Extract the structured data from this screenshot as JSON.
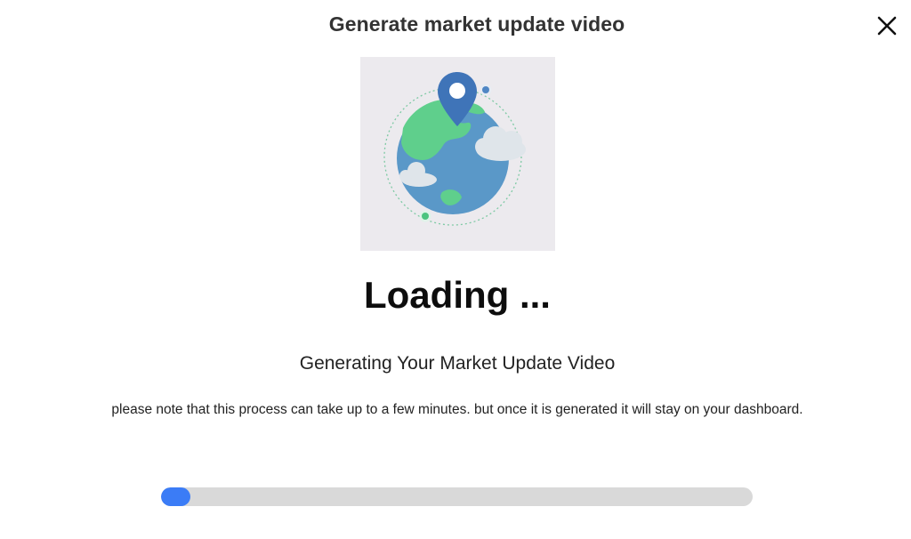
{
  "dialog": {
    "title": "Generate market update video",
    "close_icon": "close-icon",
    "illustration_icon": "globe-location-pin-icon"
  },
  "status": {
    "heading": "Loading ...",
    "subtitle": "Generating Your Market Update Video",
    "note": "please note that this process can take up to a few minutes. but once it is generated it will stay on your dashboard."
  },
  "progress": {
    "value_fraction": 0.05,
    "fill_color": "#3b7cf6",
    "track_color": "#d9d9d9"
  }
}
